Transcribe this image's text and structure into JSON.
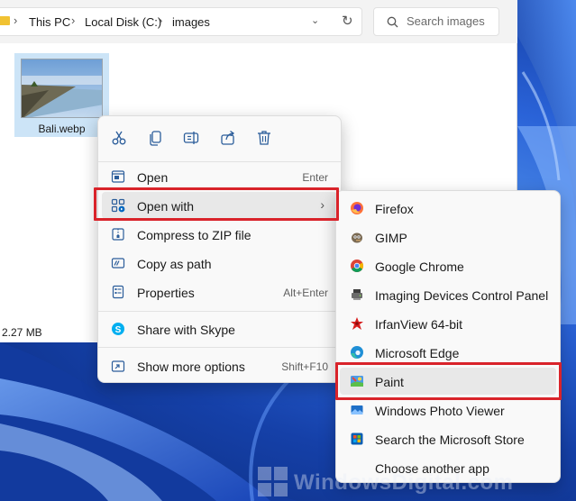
{
  "explorer": {
    "breadcrumb": [
      "This PC",
      "Local Disk (C:)",
      "images"
    ],
    "search_placeholder": "Search images",
    "file": {
      "name": "Bali.webp",
      "thumbnail_icon": "photo-thumbnail"
    },
    "status_size": "2.27 MB"
  },
  "context_menu": {
    "quick_actions": [
      {
        "name": "cut",
        "icon": "scissors-icon"
      },
      {
        "name": "copy",
        "icon": "copy-icon"
      },
      {
        "name": "rename",
        "icon": "rename-icon"
      },
      {
        "name": "share",
        "icon": "share-icon"
      },
      {
        "name": "delete",
        "icon": "trash-icon"
      }
    ],
    "items": [
      {
        "label": "Open",
        "shortcut": "Enter",
        "icon": "open-icon"
      },
      {
        "label": "Open with",
        "shortcut": "",
        "icon": "open-with-icon",
        "has_submenu": true,
        "highlighted": true
      },
      {
        "label": "Compress to ZIP file",
        "shortcut": "",
        "icon": "zip-icon"
      },
      {
        "label": "Copy as path",
        "shortcut": "",
        "icon": "copy-path-icon"
      },
      {
        "label": "Properties",
        "shortcut": "Alt+Enter",
        "icon": "properties-icon"
      },
      {
        "label": "Share with Skype",
        "shortcut": "",
        "icon": "skype-icon"
      },
      {
        "label": "Show more options",
        "shortcut": "Shift+F10",
        "icon": "more-options-icon"
      }
    ]
  },
  "open_with_menu": {
    "items": [
      {
        "label": "Firefox",
        "icon": "firefox-icon"
      },
      {
        "label": "GIMP",
        "icon": "gimp-icon"
      },
      {
        "label": "Google Chrome",
        "icon": "chrome-icon"
      },
      {
        "label": "Imaging Devices Control Panel",
        "icon": "imaging-devices-icon"
      },
      {
        "label": "IrfanView 64-bit",
        "icon": "irfanview-icon"
      },
      {
        "label": "Microsoft Edge",
        "icon": "edge-icon"
      },
      {
        "label": "Paint",
        "icon": "paint-icon",
        "highlighted": true
      },
      {
        "label": "Windows Photo Viewer",
        "icon": "photo-viewer-icon"
      },
      {
        "label": "Search the Microsoft Store",
        "icon": "store-icon"
      },
      {
        "label": "Choose another app",
        "icon": ""
      }
    ]
  },
  "watermark": {
    "text": "WindowsDigital.com"
  },
  "colors": {
    "highlight": "#d9232a",
    "menu_bg": "#f9f9f9",
    "selection": "#cce4f7",
    "accent": "#0067c0"
  }
}
